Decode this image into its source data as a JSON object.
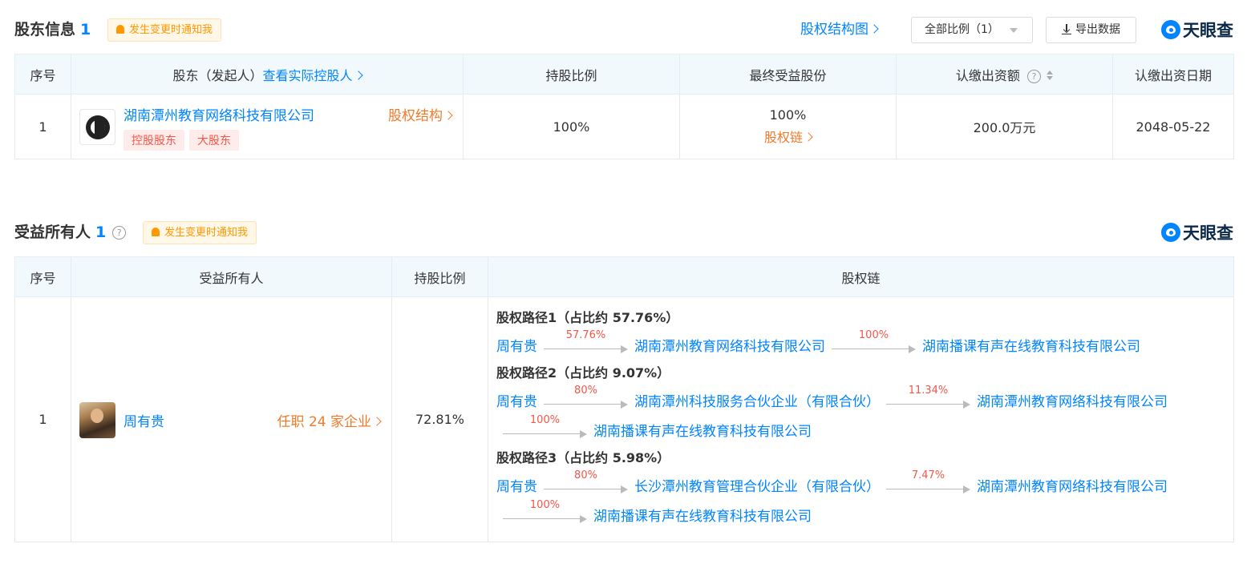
{
  "shareholders": {
    "title": "股东信息",
    "count": "1",
    "notify_label": "发生变更时通知我",
    "structure_link": "股权结构图",
    "filter_value": "全部比例（1）",
    "export_label": "导出数据",
    "logo_text": "天眼查",
    "headers": {
      "index": "序号",
      "shareholder": "股东（发起人）",
      "actual_controller_link": "查看实际控股人",
      "ratio": "持股比例",
      "final_share": "最终受益股份",
      "subscribed": "认缴出资额",
      "subscribed_date": "认缴出资日期"
    },
    "rows": [
      {
        "index": "1",
        "name": "湖南潭州教育网络科技有限公司",
        "structure_link": "股权结构",
        "tags": [
          "控股股东",
          "大股东"
        ],
        "ratio": "100%",
        "final_share": "100%",
        "chain_link": "股权链",
        "subscribed": "200.0万元",
        "subscribed_date": "2048-05-22"
      }
    ]
  },
  "beneficiaries": {
    "title": "受益所有人",
    "count": "1",
    "help_icon": "?",
    "notify_label": "发生变更时通知我",
    "logo_text": "天眼查",
    "headers": {
      "index": "序号",
      "owner": "受益所有人",
      "ratio": "持股比例",
      "chain": "股权链"
    },
    "rows": [
      {
        "index": "1",
        "name": "周有贵",
        "jobs_link": "任职 24 家企业",
        "ratio": "72.81%",
        "paths": [
          {
            "title": "股权路径1（占比约  57.76%）",
            "lines": [
              [
                {
                  "type": "node",
                  "text": "周有贵"
                },
                {
                  "type": "arrow",
                  "pct": "57.76%"
                },
                {
                  "type": "node",
                  "text": "湖南潭州教育网络科技有限公司"
                },
                {
                  "type": "arrow",
                  "pct": "100%"
                },
                {
                  "type": "node",
                  "text": "湖南播课有声在线教育科技有限公司"
                }
              ]
            ]
          },
          {
            "title": "股权路径2（占比约  9.07%）",
            "lines": [
              [
                {
                  "type": "node",
                  "text": "周有贵"
                },
                {
                  "type": "arrow",
                  "pct": "80%"
                },
                {
                  "type": "node",
                  "text": "湖南潭州科技服务合伙企业（有限合伙）"
                },
                {
                  "type": "arrow",
                  "pct": "11.34%"
                },
                {
                  "type": "node",
                  "text": "湖南潭州教育网络科技有限公司"
                }
              ],
              [
                {
                  "type": "arrow",
                  "pct": "100%"
                },
                {
                  "type": "node",
                  "text": "湖南播课有声在线教育科技有限公司"
                }
              ]
            ]
          },
          {
            "title": "股权路径3（占比约  5.98%）",
            "lines": [
              [
                {
                  "type": "node",
                  "text": "周有贵"
                },
                {
                  "type": "arrow",
                  "pct": "80%"
                },
                {
                  "type": "node",
                  "text": "长沙潭州教育管理合伙企业（有限合伙）"
                },
                {
                  "type": "arrow",
                  "pct": "7.47%"
                },
                {
                  "type": "node",
                  "text": "湖南潭州教育网络科技有限公司"
                }
              ],
              [
                {
                  "type": "arrow",
                  "pct": "100%"
                },
                {
                  "type": "node",
                  "text": "湖南播课有声在线教育科技有限公司"
                }
              ]
            ]
          }
        ]
      }
    ]
  },
  "colors": {
    "accent_blue": "#0084ff",
    "link_orange": "#f07a2a",
    "tag_red": "#f5564a",
    "notify_orange": "#ff9800",
    "header_bg": "#f2f9fc"
  },
  "icons": [
    "bell-icon",
    "chevron-right-icon",
    "caret-down-icon",
    "download-icon",
    "help-icon",
    "sort-icon",
    "tianyancha-logo"
  ]
}
